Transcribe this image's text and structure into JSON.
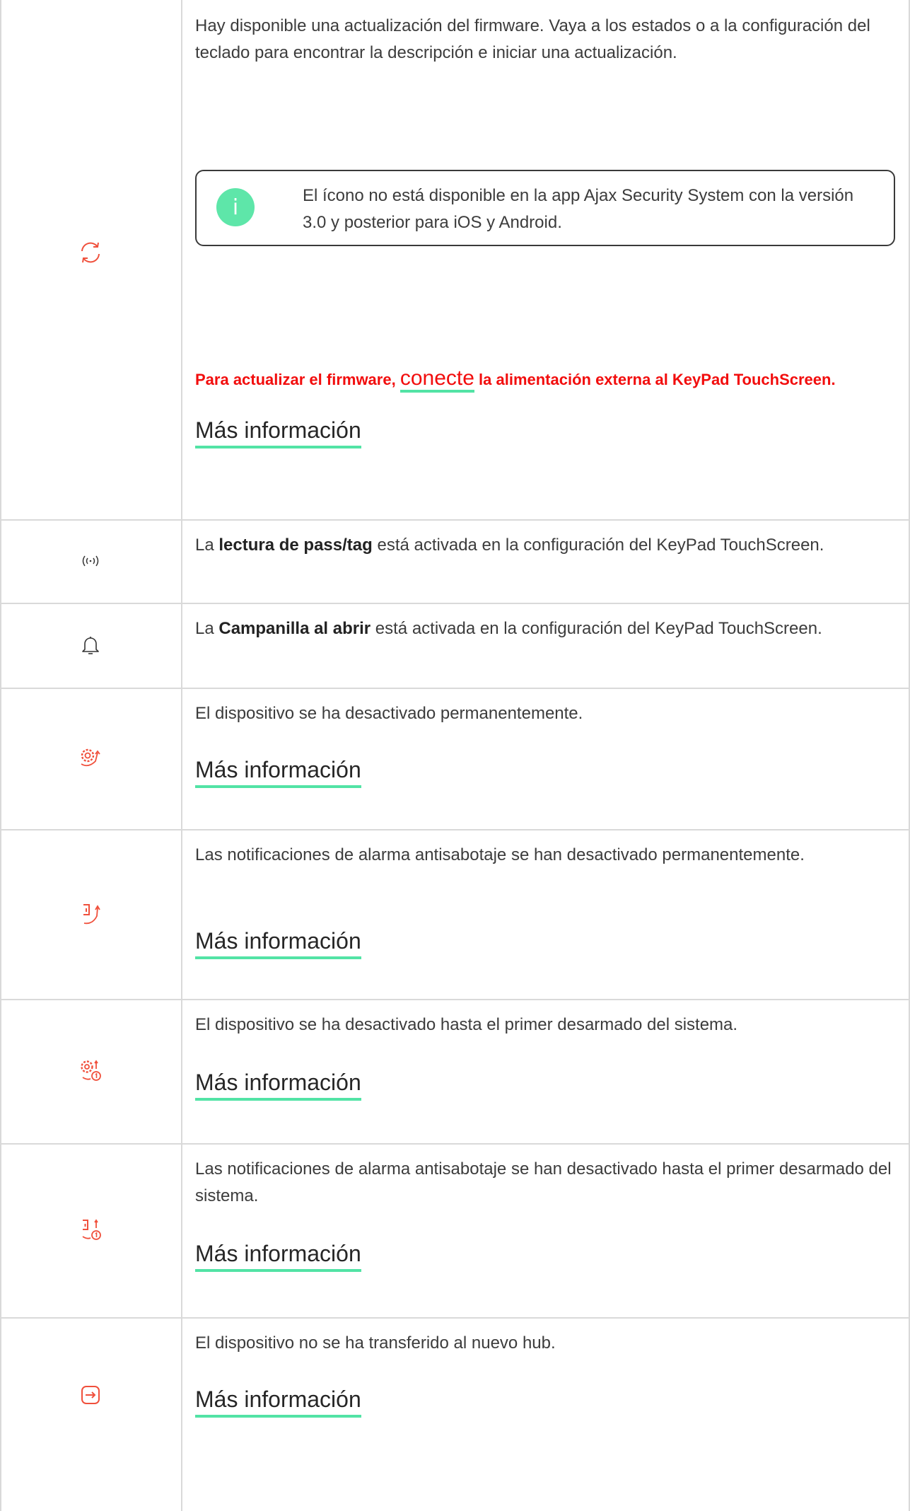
{
  "rows": {
    "firmware": {
      "icon": "refresh-icon",
      "text": "Hay disponible una actualización del firmware. Vaya a los estados o a la configuración del teclado para encontrar la descripción e iniciar una actualización.",
      "note": "El ícono no está disponible en la app Ajax Security System con la versión 3.0 y posterior para iOS y Android.",
      "warning_before": "Para actualizar el firmware, ",
      "warning_link": "conecte",
      "warning_after": " la alimentación externa al KeyPad TouchScreen.",
      "more": "Más información"
    },
    "pass_tag": {
      "icon": "rfid-icon",
      "prefix": "La ",
      "bold": "lectura de pass/tag",
      "suffix": " está activada en la configuración del KeyPad TouchScreen."
    },
    "chime": {
      "icon": "bell-icon",
      "prefix": "La ",
      "bold": "Campanilla al abrir",
      "suffix": " está activada en la configuración del KeyPad TouchScreen."
    },
    "deactivated": {
      "icon": "gear-deactivated-icon",
      "text": "El dispositivo se ha desactivado permanentemente.",
      "more": "Más información"
    },
    "tamper_off": {
      "icon": "tamper-deactivated-icon",
      "text": "Las notificaciones de alarma antisabotaje se han desactivado permanentemente.",
      "more": "Más información"
    },
    "deactivated_once": {
      "icon": "gear-once-icon",
      "text": "El dispositivo se ha desactivado hasta el primer desarmado del sistema.",
      "more": "Más información"
    },
    "tamper_once": {
      "icon": "tamper-once-icon",
      "text": "Las notificaciones de alarma antisabotaje se han desactivado hasta el primer desarmado del sistema.",
      "more": "Más información"
    },
    "not_transferred": {
      "icon": "transfer-icon",
      "text": "El dispositivo no se ha transferido al nuevo hub.",
      "more": "Más información"
    }
  },
  "colors": {
    "accent": "#52e3a5",
    "alert": "#f20d0d",
    "icon_red": "#f0503c",
    "note_icon": "#5ee6a9"
  }
}
